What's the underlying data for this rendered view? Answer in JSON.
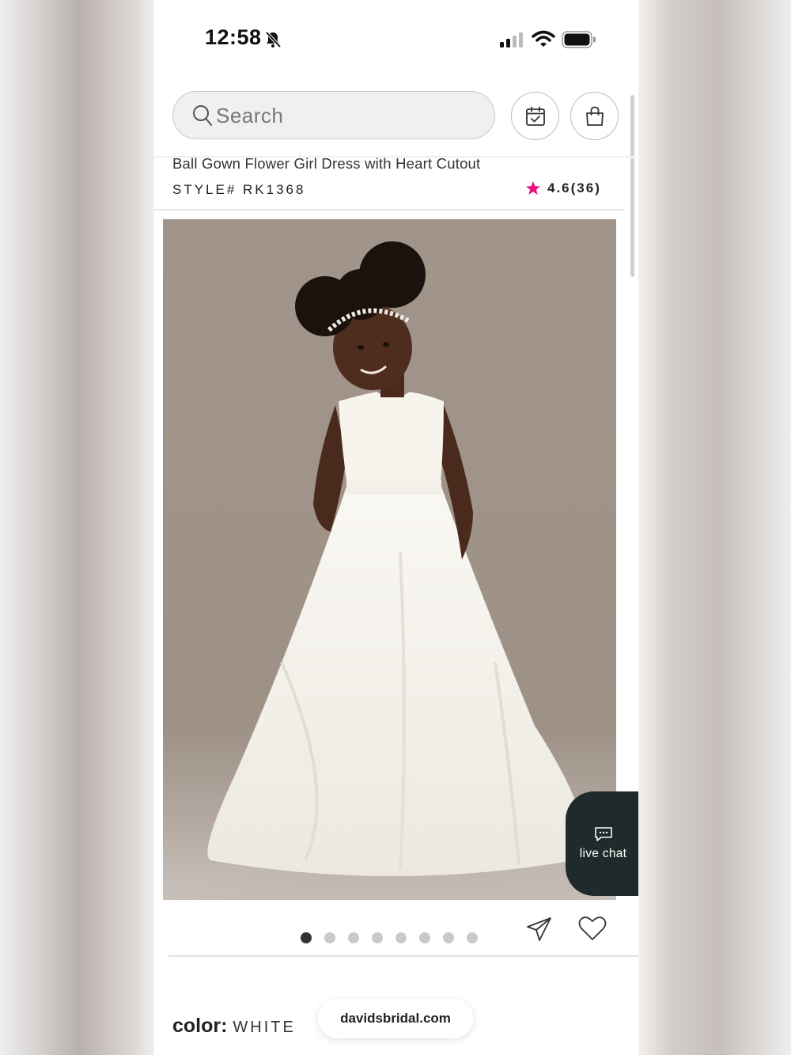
{
  "status_bar": {
    "time": "12:58"
  },
  "search": {
    "placeholder": "Search"
  },
  "product": {
    "title": "Ball Gown Flower Girl Dress with Heart Cutout",
    "style_number": "STYLE# RK1368",
    "rating": "4.6(36)",
    "rating_star_color": "#e8117f",
    "image_description_icon": "product-photo",
    "carousel": {
      "total_images": 8,
      "current_index": 0
    },
    "color_label": "color:",
    "color_value": "WHITE"
  },
  "live_chat": {
    "label": "live chat"
  },
  "browser": {
    "url": "davidsbridal.com"
  },
  "colors": {
    "chat_bg": "#1f2b2a",
    "photo_bg": "#a79a8f"
  }
}
